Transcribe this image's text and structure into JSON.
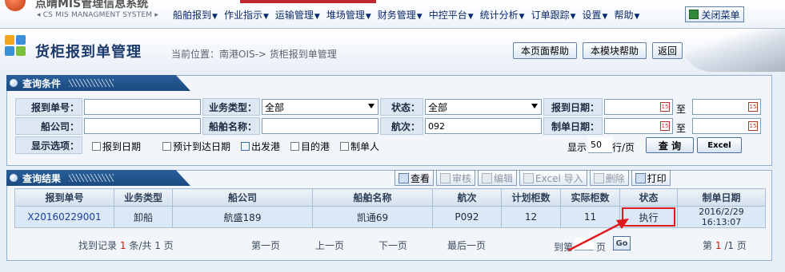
{
  "app": {
    "title": "点晴MIS管理信息系统",
    "subtitle": "◂ CS MIS MANAGMENT SYSTEM ▸"
  },
  "menu": [
    "船舶报到",
    "作业指示",
    "运输管理",
    "堆场管理",
    "财务管理",
    "中控平台",
    "统计分析",
    "订单跟踪",
    "设置",
    "帮助"
  ],
  "close_menu_label": "关闭菜单",
  "page": {
    "title": "货柜报到单管理",
    "location": "当前位置：南港OIS-> 货柜报到单管理",
    "help_page": "本页面帮助",
    "help_module": "本模块帮助",
    "back": "返回"
  },
  "query": {
    "tab": "查询条件",
    "report_no_label": "报到单号：",
    "report_no_value": "",
    "biz_type_label": "业务类型：",
    "biz_type_value": "全部",
    "status_label": "状态：",
    "status_value": "全部",
    "report_date_label": "报到日期：",
    "report_date_from": "",
    "report_date_to": "",
    "to_label": "至",
    "ship_company_label": "船公司：",
    "ship_company_value": "",
    "ship_name_label": "船舶名称：",
    "ship_name_value": "",
    "voyage_label": "航次：",
    "voyage_value": "092",
    "create_date_label": "制单日期：",
    "create_date_from": "",
    "create_date_to": "",
    "display_label": "显示选项：",
    "options": [
      {
        "label": "报到日期",
        "checked": false
      },
      {
        "label": "预计到达日期",
        "checked": false
      },
      {
        "label": "出发港",
        "checked": true
      },
      {
        "label": "目的港",
        "checked": false
      },
      {
        "label": "制单人",
        "checked": false
      }
    ],
    "show_prefix": "显示",
    "rows_per_page": "50",
    "rows_suffix": "行/页",
    "search_btn": "查 询",
    "excel_btn": "Excel"
  },
  "results": {
    "tab": "查询结果",
    "toolbar": [
      {
        "label": "查看",
        "enabled": true,
        "icon": "view-icon"
      },
      {
        "label": "审核",
        "enabled": false,
        "icon": "audit-icon"
      },
      {
        "label": "编辑",
        "enabled": false,
        "icon": "edit-icon"
      },
      {
        "label": "Excel 导入",
        "enabled": false,
        "icon": "excel-import-icon"
      },
      {
        "label": "删除",
        "enabled": false,
        "icon": "delete-icon"
      },
      {
        "label": "打印",
        "enabled": true,
        "icon": "print-icon"
      }
    ],
    "columns": [
      "报到单号",
      "业务类型",
      "船公司",
      "船舶名称",
      "航次",
      "计划柜数",
      "实际柜数",
      "状态",
      "制单日期"
    ],
    "rows": [
      [
        "X20160229001",
        "卸船",
        "航盛189",
        "凯通69",
        "P092",
        "12",
        "11",
        "执行",
        "2016/2/29 16:13:07"
      ]
    ],
    "pager": {
      "found_prefix": "找到记录",
      "total_records": "1",
      "found_mid": "条/共",
      "total_pages": "1",
      "found_suffix": "页",
      "first": "第一页",
      "prev": "上一页",
      "next": "下一页",
      "last": "最后一页",
      "goto_prefix": "到第",
      "goto_suffix": "页",
      "go": "Go",
      "page_prefix": "第",
      "current_page": "1",
      "page_sep": "/1",
      "page_suffix": "页"
    }
  },
  "colors": {
    "tab_blue": "#1b4a80",
    "highlight_red": "#e0191f",
    "row_bg": "#dbe8f6"
  }
}
